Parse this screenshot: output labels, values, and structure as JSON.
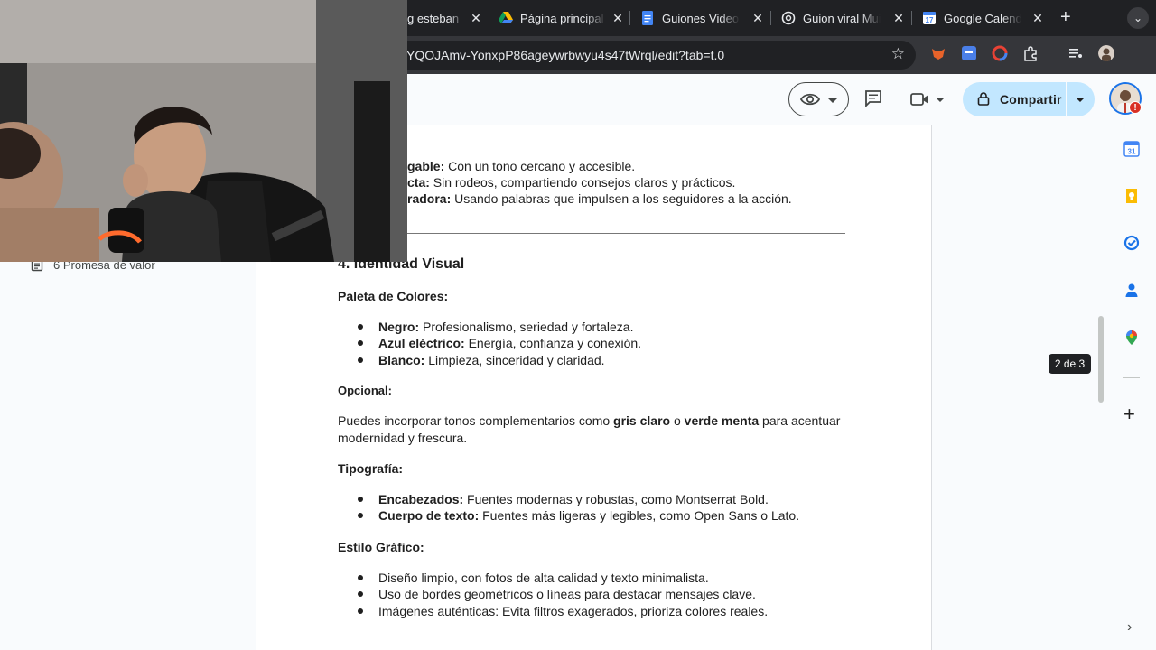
{
  "browser": {
    "tabs": [
      {
        "title": "g esteban",
        "icon": "tab-icon"
      },
      {
        "title": "Página principal",
        "icon": "google-drive-icon"
      },
      {
        "title": "Guiones Videos",
        "icon": "google-docs-icon"
      },
      {
        "title": "Guion viral Muich",
        "icon": "chatgpt-icon"
      },
      {
        "title": "Google Calendar",
        "icon": "google-calendar-icon"
      }
    ],
    "close_glyph": "✕",
    "new_tab_glyph": "+",
    "tab_search_glyph": "⌄",
    "url": "YQOJAmv-YonxpP86ageywrbwyu4s47tWrql/edit?tab=t.0",
    "star_glyph": "☆"
  },
  "docs_header": {
    "share_label": "Compartir",
    "avatar_badge": "!"
  },
  "outline": {
    "item_label": "6 Promesa de valor"
  },
  "document": {
    "top_lines": [
      {
        "bold": "gable:",
        "text": " Con un tono cercano y accesible."
      },
      {
        "bold": "cta:",
        "text": " Sin rodeos, compartiendo consejos claros y prácticos."
      },
      {
        "bold": "radora:",
        "text": " Usando palabras que impulsen a los seguidores a la acción."
      }
    ],
    "heading": "4. Identidad Visual",
    "palette_title": "Paleta de Colores:",
    "palette": [
      {
        "bold": "Negro:",
        "text": " Profesionalismo, seriedad y fortaleza."
      },
      {
        "bold": "Azul eléctrico:",
        "text": " Energía, confianza y conexión."
      },
      {
        "bold": "Blanco:",
        "text": " Limpieza, sinceridad y claridad."
      }
    ],
    "optional_title": "Opcional:",
    "optional_p1": "Puedes incorporar tonos complementarios como ",
    "optional_b1": "gris claro",
    "optional_p2": " o ",
    "optional_b2": "verde menta",
    "optional_p3": " para acentuar",
    "optional_line2": "modernidad y frescura.",
    "typography_title": "Tipografía:",
    "typography": [
      {
        "bold": "Encabezados:",
        "text": " Fuentes modernas y robustas, como Montserrat Bold."
      },
      {
        "bold": "Cuerpo de texto:",
        "text": " Fuentes más ligeras y legibles, como Open Sans o Lato."
      }
    ],
    "style_title": "Estilo Gráfico:",
    "style": [
      "Diseño limpio, con fotos de alta calidad y texto minimalista.",
      "Uso de bordes geométricos o líneas para destacar mensajes clave.",
      "Imágenes auténticas: Evita filtros exagerados, prioriza colores reales."
    ]
  },
  "side_panel": {
    "page_indicator": "2 de 3",
    "add_glyph": "+",
    "collapse_glyph": "›",
    "apps": [
      "calendar-icon",
      "keep-icon",
      "tasks-icon",
      "contacts-icon",
      "maps-icon"
    ]
  },
  "colors": {
    "accent": "#1a73e8",
    "share_bg": "#c2e7ff",
    "tab_strip": "#202124"
  }
}
